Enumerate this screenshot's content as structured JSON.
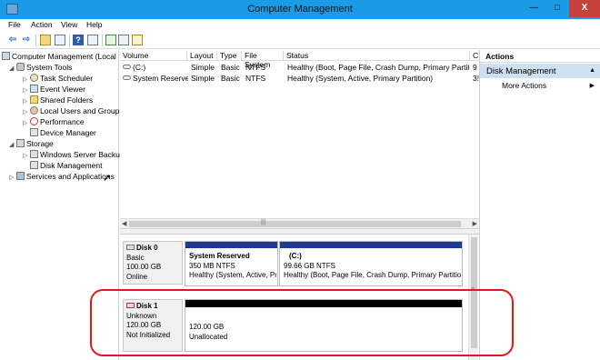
{
  "window": {
    "title": "Computer Management",
    "minimize": "—",
    "maximize": "□",
    "close": "X"
  },
  "menu": [
    "File",
    "Action",
    "View",
    "Help"
  ],
  "toolbar": {
    "back": "⇦",
    "forward": "⇨",
    "icons": [
      "up-folder-icon",
      "show-tree-icon",
      "help-icon",
      "action-pane-icon",
      "refresh-icon",
      "properties-icon",
      "export-icon"
    ]
  },
  "tree": {
    "root": "Computer Management (Local",
    "system_tools": "System Tools",
    "task_scheduler": "Task Scheduler",
    "event_viewer": "Event Viewer",
    "shared_folders": "Shared Folders",
    "local_users": "Local Users and Groups",
    "performance": "Performance",
    "device_manager": "Device Manager",
    "storage": "Storage",
    "wsb": "Windows Server Backup",
    "disk_mgmt": "Disk Management",
    "services": "Services and Applications"
  },
  "volumes": {
    "headers": [
      "Volume",
      "Layout",
      "Type",
      "File System",
      "Status",
      "C"
    ],
    "rows": [
      {
        "volume": "(C:)",
        "layout": "Simple",
        "type": "Basic",
        "fs": "NTFS",
        "status": "Healthy (Boot, Page File, Crash Dump, Primary Partition)",
        "cap": "9"
      },
      {
        "volume": "System Reserved",
        "layout": "Simple",
        "type": "Basic",
        "fs": "NTFS",
        "status": "Healthy (System, Active, Primary Partition)",
        "cap": "3!"
      }
    ]
  },
  "disks": {
    "disk0": {
      "name": "Disk 0",
      "type": "Basic",
      "size": "100.00 GB",
      "status": "Online",
      "partitions": [
        {
          "name": "System Reserved",
          "size": "350 MB NTFS",
          "status": "Healthy (System, Active, Pr"
        },
        {
          "name": "(C:)",
          "size": "99.66 GB NTFS",
          "status": "Healthy (Boot, Page File, Crash Dump, Primary Partitio"
        }
      ]
    },
    "disk1": {
      "name": "Disk 1",
      "type": "Unknown",
      "size": "120.00 GB",
      "status": "Not Initialized",
      "unalloc_size": "120.00 GB",
      "unalloc_label": "Unallocated"
    }
  },
  "actions": {
    "header": "Actions",
    "section": "Disk Management",
    "more": "More Actions"
  },
  "colors": {
    "titlebar": "#1b9ae6",
    "primary_partition": "#1f3a8f",
    "unallocated": "#000000",
    "highlight": "#e01919",
    "actions_section": "#cfe0f0"
  }
}
